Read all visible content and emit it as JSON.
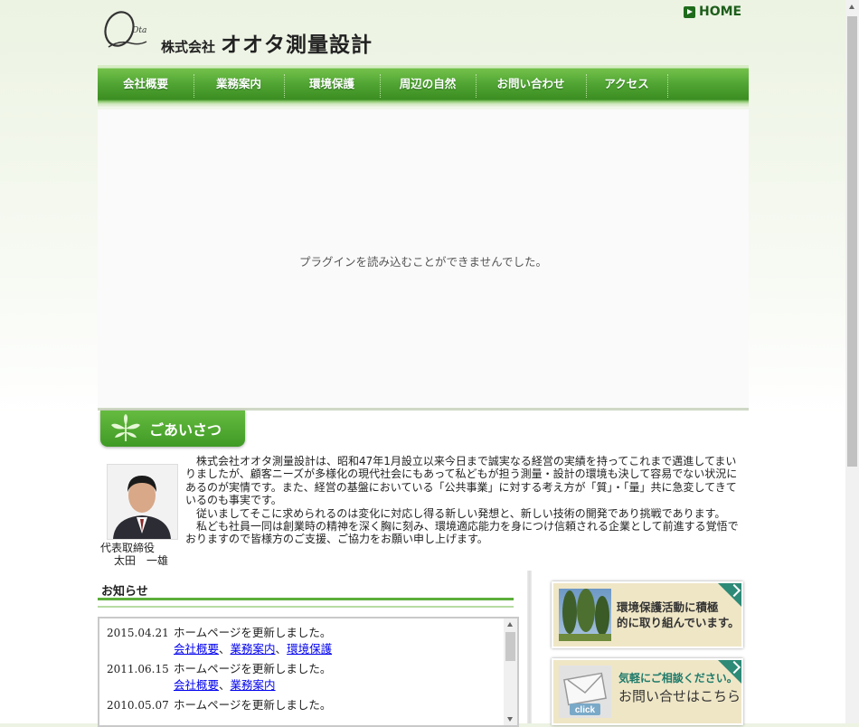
{
  "header": {
    "logo_script": "Ota",
    "company_prefix": "株式会社",
    "company_name": "オオタ測量設計",
    "home_label": "HOME"
  },
  "nav": {
    "items": [
      {
        "label": "会社概要"
      },
      {
        "label": "業務案内"
      },
      {
        "label": "環境保護"
      },
      {
        "label": "周辺の自然"
      },
      {
        "label": "お問い合わせ"
      },
      {
        "label": "アクセス"
      }
    ]
  },
  "visual": {
    "plugin_message": "プラグインを読み込むことができませんでした。"
  },
  "greeting": {
    "section_title": "ごあいさつ",
    "role": "代表取締役",
    "name": "太田　一雄",
    "paragraphs": [
      "株式会社オオタ測量設計は、昭和47年1月設立以来今日まで誠実なる経営の実績を持ってこれまで邁進してまいりましたが、顧客ニーズが多様化の現代社会にもあって私どもが担う測量・設計の環境も決して容易でない状況にあるのが実情です。また、経営の基盤においている「公共事業」に対する考え方が「質」・「量」共に急変してきているのも事実です。",
      "従いましてそこに求められるのは変化に対応し得る新しい発想と、新しい技術の開発であり挑戦であります。",
      "私ども社員一同は創業時の精神を深く胸に刻み、環境適応能力を身につけ信頼される企業として前進する覚悟でおりますので皆様方のご支援、ご協力をお願い申し上げます。"
    ]
  },
  "news": {
    "title": "お知らせ",
    "entries": [
      {
        "date": "2015.04.21",
        "text": "ホームページを更新しました。",
        "links": [
          "会社概要",
          "業務案内",
          "環境保護"
        ]
      },
      {
        "date": "2011.06.15",
        "text": "ホームページを更新しました。",
        "links": [
          "会社概要",
          "業務案内"
        ]
      },
      {
        "date": "2010.05.07",
        "text": "ホームページを更新しました。",
        "links": []
      }
    ],
    "separator": "、"
  },
  "banners": {
    "env": {
      "line1": "環境保護活動に積極",
      "line2": "的に取り組んでいます。"
    },
    "contact": {
      "small": "気軽にご相談ください。",
      "large": "お問い合せはこちら",
      "click_label": "click"
    }
  },
  "colors": {
    "nav_green": "#52a634",
    "accent_teal": "#2d8a77",
    "banner_bg": "#efe6c6",
    "link": "#0000ee"
  }
}
